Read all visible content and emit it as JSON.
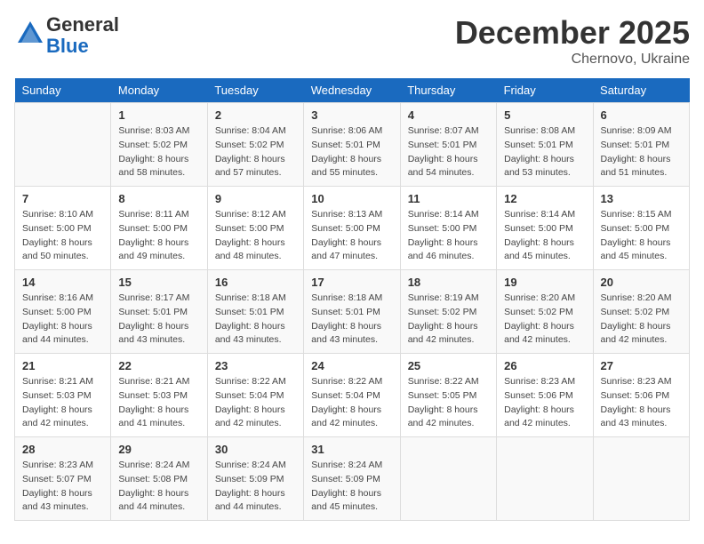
{
  "logo": {
    "general": "General",
    "blue": "Blue"
  },
  "title": "December 2025",
  "location": "Chernovo, Ukraine",
  "days_of_week": [
    "Sunday",
    "Monday",
    "Tuesday",
    "Wednesday",
    "Thursday",
    "Friday",
    "Saturday"
  ],
  "weeks": [
    [
      {
        "day": "",
        "sunrise": "",
        "sunset": "",
        "daylight": ""
      },
      {
        "day": "1",
        "sunrise": "8:03 AM",
        "sunset": "5:02 PM",
        "daylight": "8 hours and 58 minutes."
      },
      {
        "day": "2",
        "sunrise": "8:04 AM",
        "sunset": "5:02 PM",
        "daylight": "8 hours and 57 minutes."
      },
      {
        "day": "3",
        "sunrise": "8:06 AM",
        "sunset": "5:01 PM",
        "daylight": "8 hours and 55 minutes."
      },
      {
        "day": "4",
        "sunrise": "8:07 AM",
        "sunset": "5:01 PM",
        "daylight": "8 hours and 54 minutes."
      },
      {
        "day": "5",
        "sunrise": "8:08 AM",
        "sunset": "5:01 PM",
        "daylight": "8 hours and 53 minutes."
      },
      {
        "day": "6",
        "sunrise": "8:09 AM",
        "sunset": "5:01 PM",
        "daylight": "8 hours and 51 minutes."
      }
    ],
    [
      {
        "day": "7",
        "sunrise": "8:10 AM",
        "sunset": "5:00 PM",
        "daylight": "8 hours and 50 minutes."
      },
      {
        "day": "8",
        "sunrise": "8:11 AM",
        "sunset": "5:00 PM",
        "daylight": "8 hours and 49 minutes."
      },
      {
        "day": "9",
        "sunrise": "8:12 AM",
        "sunset": "5:00 PM",
        "daylight": "8 hours and 48 minutes."
      },
      {
        "day": "10",
        "sunrise": "8:13 AM",
        "sunset": "5:00 PM",
        "daylight": "8 hours and 47 minutes."
      },
      {
        "day": "11",
        "sunrise": "8:14 AM",
        "sunset": "5:00 PM",
        "daylight": "8 hours and 46 minutes."
      },
      {
        "day": "12",
        "sunrise": "8:14 AM",
        "sunset": "5:00 PM",
        "daylight": "8 hours and 45 minutes."
      },
      {
        "day": "13",
        "sunrise": "8:15 AM",
        "sunset": "5:00 PM",
        "daylight": "8 hours and 45 minutes."
      }
    ],
    [
      {
        "day": "14",
        "sunrise": "8:16 AM",
        "sunset": "5:00 PM",
        "daylight": "8 hours and 44 minutes."
      },
      {
        "day": "15",
        "sunrise": "8:17 AM",
        "sunset": "5:01 PM",
        "daylight": "8 hours and 43 minutes."
      },
      {
        "day": "16",
        "sunrise": "8:18 AM",
        "sunset": "5:01 PM",
        "daylight": "8 hours and 43 minutes."
      },
      {
        "day": "17",
        "sunrise": "8:18 AM",
        "sunset": "5:01 PM",
        "daylight": "8 hours and 43 minutes."
      },
      {
        "day": "18",
        "sunrise": "8:19 AM",
        "sunset": "5:02 PM",
        "daylight": "8 hours and 42 minutes."
      },
      {
        "day": "19",
        "sunrise": "8:20 AM",
        "sunset": "5:02 PM",
        "daylight": "8 hours and 42 minutes."
      },
      {
        "day": "20",
        "sunrise": "8:20 AM",
        "sunset": "5:02 PM",
        "daylight": "8 hours and 42 minutes."
      }
    ],
    [
      {
        "day": "21",
        "sunrise": "8:21 AM",
        "sunset": "5:03 PM",
        "daylight": "8 hours and 42 minutes."
      },
      {
        "day": "22",
        "sunrise": "8:21 AM",
        "sunset": "5:03 PM",
        "daylight": "8 hours and 41 minutes."
      },
      {
        "day": "23",
        "sunrise": "8:22 AM",
        "sunset": "5:04 PM",
        "daylight": "8 hours and 42 minutes."
      },
      {
        "day": "24",
        "sunrise": "8:22 AM",
        "sunset": "5:04 PM",
        "daylight": "8 hours and 42 minutes."
      },
      {
        "day": "25",
        "sunrise": "8:22 AM",
        "sunset": "5:05 PM",
        "daylight": "8 hours and 42 minutes."
      },
      {
        "day": "26",
        "sunrise": "8:23 AM",
        "sunset": "5:06 PM",
        "daylight": "8 hours and 42 minutes."
      },
      {
        "day": "27",
        "sunrise": "8:23 AM",
        "sunset": "5:06 PM",
        "daylight": "8 hours and 43 minutes."
      }
    ],
    [
      {
        "day": "28",
        "sunrise": "8:23 AM",
        "sunset": "5:07 PM",
        "daylight": "8 hours and 43 minutes."
      },
      {
        "day": "29",
        "sunrise": "8:24 AM",
        "sunset": "5:08 PM",
        "daylight": "8 hours and 44 minutes."
      },
      {
        "day": "30",
        "sunrise": "8:24 AM",
        "sunset": "5:09 PM",
        "daylight": "8 hours and 44 minutes."
      },
      {
        "day": "31",
        "sunrise": "8:24 AM",
        "sunset": "5:09 PM",
        "daylight": "8 hours and 45 minutes."
      },
      {
        "day": "",
        "sunrise": "",
        "sunset": "",
        "daylight": ""
      },
      {
        "day": "",
        "sunrise": "",
        "sunset": "",
        "daylight": ""
      },
      {
        "day": "",
        "sunrise": "",
        "sunset": "",
        "daylight": ""
      }
    ]
  ],
  "labels": {
    "sunrise_prefix": "Sunrise: ",
    "sunset_prefix": "Sunset: ",
    "daylight_label": "Daylight: "
  }
}
